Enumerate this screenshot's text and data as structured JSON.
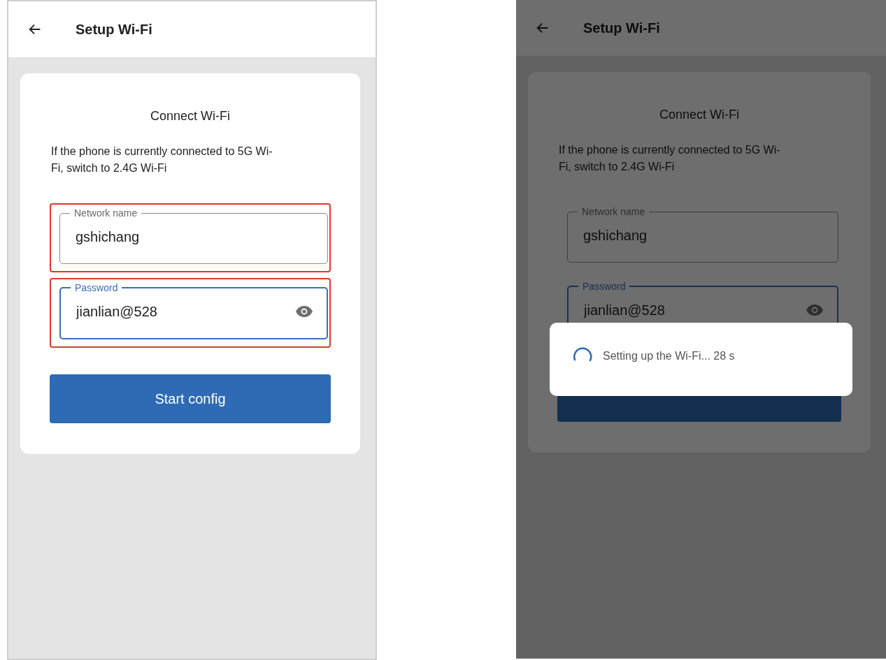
{
  "screens": [
    {
      "title": "Setup Wi-Fi",
      "heading": "Connect Wi-Fi",
      "note": "If the phone is currently connected to 5G Wi-Fi, switch to 2.4G Wi-Fi",
      "fields": [
        {
          "kind": "text",
          "label": "Network name",
          "value": "gshichang",
          "focused": false,
          "highlighted": true
        },
        {
          "kind": "password",
          "label": "Password",
          "value": "jianlian@528",
          "focused": true,
          "highlighted": true
        }
      ],
      "button": {
        "label": "Start config"
      }
    },
    {
      "dimmed": true,
      "title": "Setup Wi-Fi",
      "heading": "Connect Wi-Fi",
      "note": "If the phone is currently connected to 5G Wi-Fi, switch to 2.4G Wi-Fi",
      "fields": [
        {
          "kind": "text",
          "label": "Network name",
          "value": "gshichang",
          "focused": false,
          "highlighted": false
        },
        {
          "kind": "password",
          "label": "Password",
          "value": "jianlian@528",
          "focused": true,
          "highlighted": false
        }
      ],
      "dialog": {
        "message": "Setting up the Wi-Fi... 28 s"
      }
    }
  ]
}
